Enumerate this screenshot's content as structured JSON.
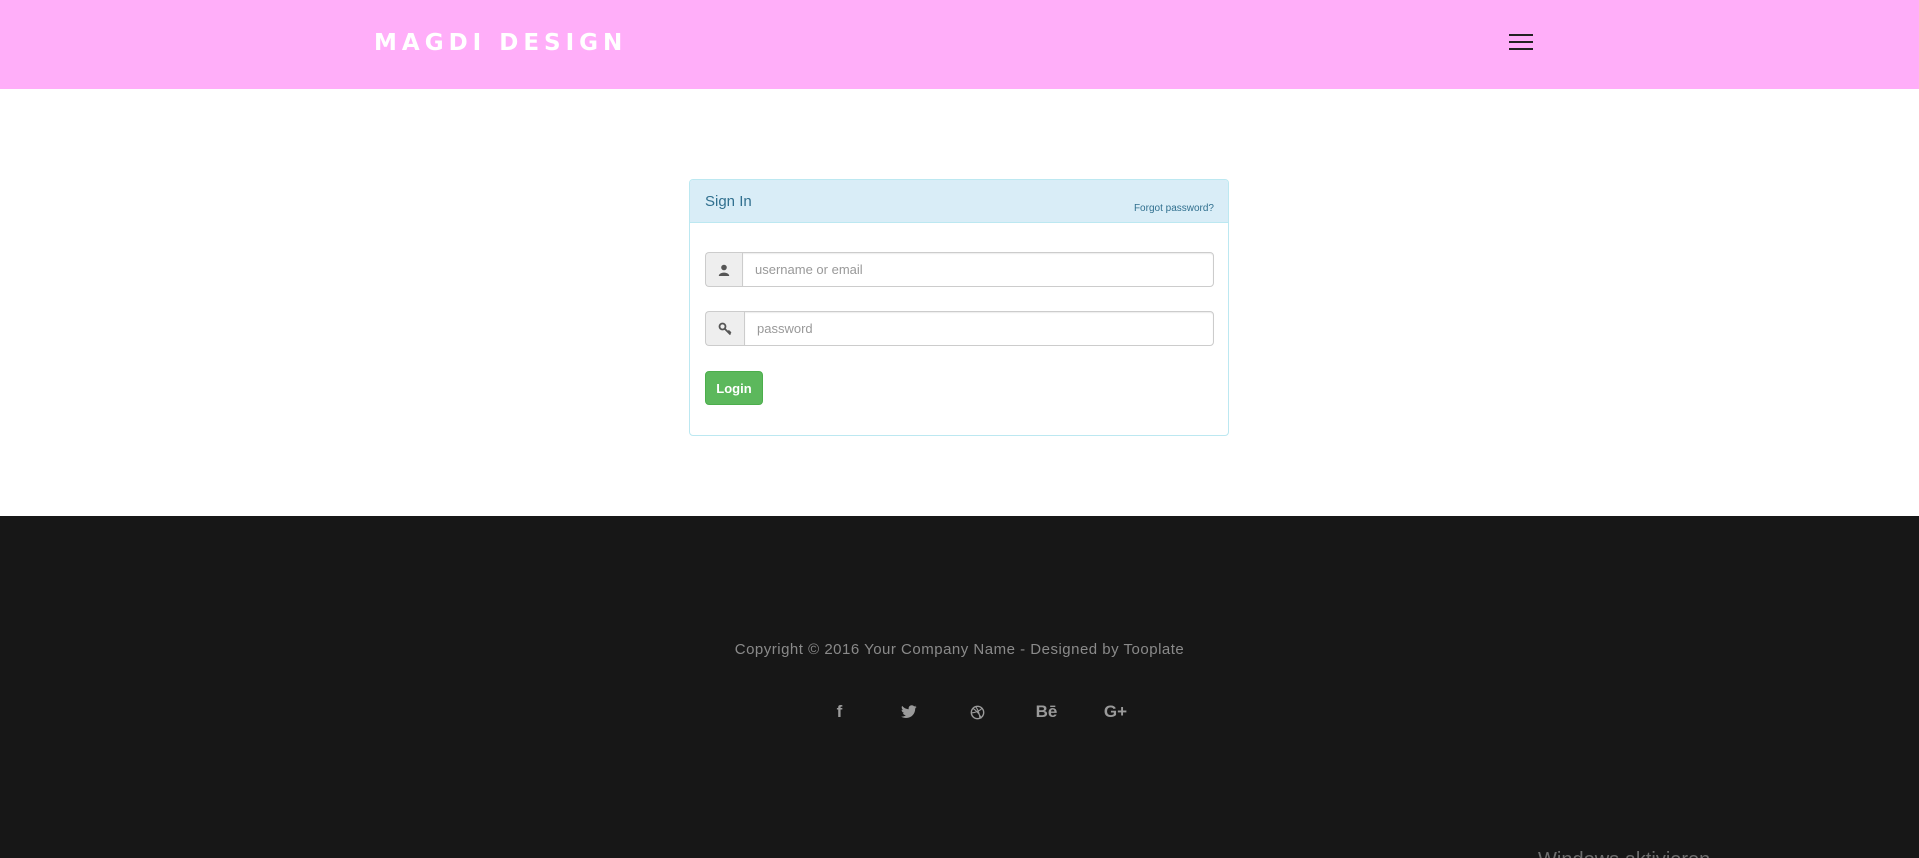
{
  "navbar": {
    "brand": "MAGDI DESIGN",
    "menu_icon": "hamburger-menu-icon",
    "background": "#ffaef9"
  },
  "signin": {
    "title": "Sign In",
    "forgot_link": "Forgot password?",
    "username_placeholder": "username or email",
    "username_value": "",
    "username_icon": "user-icon",
    "password_placeholder": "password",
    "password_value": "",
    "password_icon": "key-icon",
    "login_label": "Login"
  },
  "footer": {
    "copyright": "Copyright © 2016 Your Company Name - Designed by Tooplate",
    "social": [
      {
        "name": "facebook-icon",
        "glyph": "f"
      },
      {
        "name": "twitter-icon",
        "glyph": ""
      },
      {
        "name": "dribbble-icon",
        "glyph": ""
      },
      {
        "name": "behance-icon",
        "glyph": "Bē"
      },
      {
        "name": "google-plus-icon",
        "glyph": "G+"
      }
    ],
    "watermark": "Windows aktivieren"
  },
  "colors": {
    "accent_green": "#5cb85c",
    "panel_heading": "#d9edf7",
    "footer_bg": "#171717"
  }
}
